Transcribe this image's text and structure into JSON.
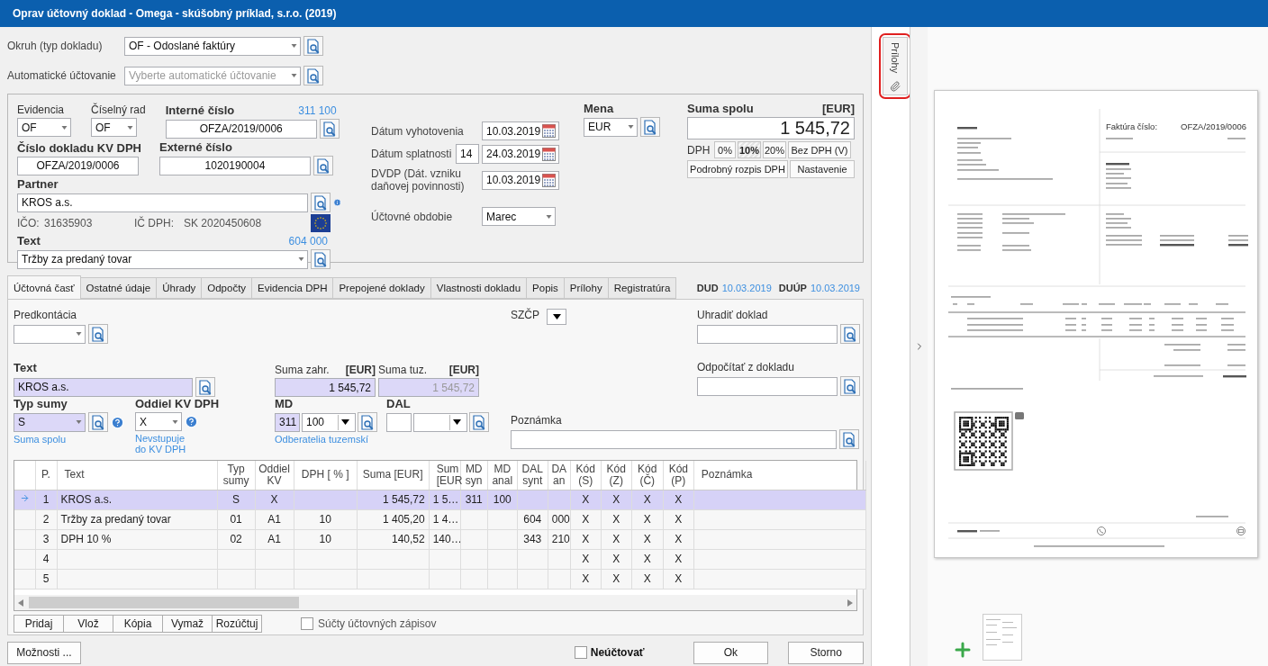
{
  "window": {
    "title": "Oprav účtovný doklad - Omega - skúšobný príklad, s.r.o. (2019)"
  },
  "header_fields": [
    {
      "label": "Okruh (typ dokladu)",
      "value": "OF - Odoslané faktúry"
    },
    {
      "label": "Automatické účtovanie",
      "placeholder": "Vyberte automatické účtovanie"
    }
  ],
  "document": {
    "evidencia": {
      "label": "Evidencia",
      "value": "OF"
    },
    "ciselny_rad": {
      "label": "Číselný rad",
      "value": "OF"
    },
    "interne_cislo": {
      "label": "Interné číslo",
      "accounts": [
        "311",
        "100"
      ],
      "value": "OFZA/2019/0006"
    },
    "cislo_kv": {
      "label": "Číslo dokladu KV DPH",
      "value": "OFZA/2019/0006"
    },
    "externe_cislo": {
      "label": "Externé číslo",
      "value": "1020190004"
    },
    "partner": {
      "label": "Partner",
      "value": "KROS a.s.",
      "ico_label": "IČO:",
      "ico": "31635903",
      "icdph_label": "IČ DPH:",
      "icdph": "SK 2020450608"
    },
    "text": {
      "label": "Text",
      "accounts": [
        "604",
        "000"
      ],
      "value": "Tržby za predaný tovar"
    },
    "dates": [
      {
        "label": "Dátum vyhotovenia",
        "value": "10.03.2019"
      },
      {
        "label": "Dátum splatnosti",
        "days": "14",
        "value": "24.03.2019"
      },
      {
        "label": "DVDP (Dát. vzniku daňovej povinnosti)",
        "value": "10.03.2019"
      }
    ],
    "period": {
      "label": "Účtovné obdobie",
      "value": "Marec"
    },
    "currency": {
      "label": "Mena",
      "value": "EUR"
    },
    "total": {
      "label": "Suma spolu",
      "unit": "[EUR]",
      "value": "1 545,72"
    },
    "vat_label": "DPH",
    "vat_buttons": [
      {
        "label": "0%",
        "selected": false
      },
      {
        "label": "10%",
        "selected": true
      },
      {
        "label": "20%",
        "selected": false
      },
      {
        "label": "Bez DPH (V)",
        "selected": false
      }
    ],
    "buttons": [
      "Podrobný rozpis DPH",
      "Nastavenie"
    ]
  },
  "tabs": [
    {
      "label": "Účtovná časť",
      "selected": true
    },
    {
      "label": "Ostatné údaje",
      "selected": false
    },
    {
      "label": "Úhrady",
      "selected": false
    },
    {
      "label": "Odpočty",
      "selected": false
    },
    {
      "label": "Evidencia DPH",
      "selected": false
    },
    {
      "label": "Prepojené doklady",
      "selected": false
    },
    {
      "label": "Vlastnosti dokladu",
      "selected": false
    },
    {
      "label": "Popis",
      "selected": false
    },
    {
      "label": "Prílohy",
      "selected": false
    },
    {
      "label": "Registratúra",
      "selected": false
    }
  ],
  "tab_dates": [
    {
      "label": "DUD",
      "value": "10.03.2019"
    },
    {
      "label": "DUÚP",
      "value": "10.03.2019"
    }
  ],
  "entry": {
    "predkontacia": {
      "label": "Predkontácia"
    },
    "szcp": {
      "label": "SZČP"
    },
    "pay_doc": {
      "label": "Uhradiť doklad"
    },
    "text": {
      "label": "Text",
      "value": "KROS a.s."
    },
    "amounts": [
      {
        "label": "Suma zahr.",
        "unit": "[EUR]",
        "value": "1 545,72",
        "disabled": false
      },
      {
        "label": "Suma tuz.",
        "unit": "[EUR]",
        "value": "1 545,72",
        "disabled": true
      }
    ],
    "deduct_doc": {
      "label": "Odpočítať z dokladu"
    },
    "typ_sumy": {
      "label": "Typ sumy",
      "value": "S",
      "hint": "Suma spolu"
    },
    "oddiel": {
      "label": "Oddiel KV DPH",
      "value": "X",
      "hint": "Nevstupuje do KV DPH"
    },
    "md": {
      "label": "MD",
      "syn": "311",
      "anal": "100",
      "hint": "Odberatelia tuzemskí"
    },
    "dal": {
      "label": "DAL"
    },
    "note": {
      "label": "Poznámka"
    }
  },
  "table": {
    "columns": [
      "P.",
      "Text",
      "Typ\nsumy",
      "Oddiel\nKV",
      "DPH [ % ]",
      "Suma [EUR]",
      "Sum\n[EUR",
      "MD\nsyn",
      "MD\nanal",
      "DAL\nsynt",
      "DA\nan",
      "Kód\n(S)",
      "Kód\n(Z)",
      "Kód\n(Č)",
      "Kód\n(P)",
      "Poznámka"
    ],
    "rows": [
      {
        "selected": true,
        "cells": [
          "1",
          "KROS a.s.",
          "S",
          "X",
          null,
          "1 545,72",
          "1 5…",
          "311",
          "100",
          null,
          null,
          "X",
          "X",
          "X",
          "X",
          null
        ]
      },
      {
        "selected": false,
        "cells": [
          "2",
          "Tržby za predaný tovar",
          "01",
          "A1",
          "10",
          "1 405,20",
          "1 4…",
          null,
          null,
          "604",
          "000",
          "X",
          "X",
          "X",
          "X",
          null
        ]
      },
      {
        "selected": false,
        "cells": [
          "3",
          "DPH 10 %",
          "02",
          "A1",
          "10",
          "140,52",
          "140…",
          null,
          null,
          "343",
          "210",
          "X",
          "X",
          "X",
          "X",
          null
        ]
      },
      {
        "selected": false,
        "cells": [
          "4",
          null,
          null,
          null,
          null,
          null,
          null,
          null,
          null,
          null,
          null,
          "X",
          "X",
          "X",
          "X",
          null
        ]
      },
      {
        "selected": false,
        "cells": [
          "5",
          null,
          null,
          null,
          null,
          null,
          null,
          null,
          null,
          null,
          null,
          "X",
          "X",
          "X",
          "X",
          null
        ]
      }
    ]
  },
  "row_buttons": [
    "Pridaj",
    "Vlož",
    "Kópia",
    "Vymaž",
    "Rozúčtuj"
  ],
  "sums_checkbox": {
    "label": "Súčty účtovných zápisov",
    "checked": false
  },
  "footer": {
    "options": "Možnosti ...",
    "no_post": {
      "label": "Neúčtovať",
      "checked": false
    },
    "ok": "Ok",
    "cancel": "Storno"
  },
  "side_tab": {
    "label": "Prílohy"
  },
  "preview": {
    "invoice_title": "Faktúra číslo:",
    "invoice_number": "OFZA/2019/0006"
  }
}
